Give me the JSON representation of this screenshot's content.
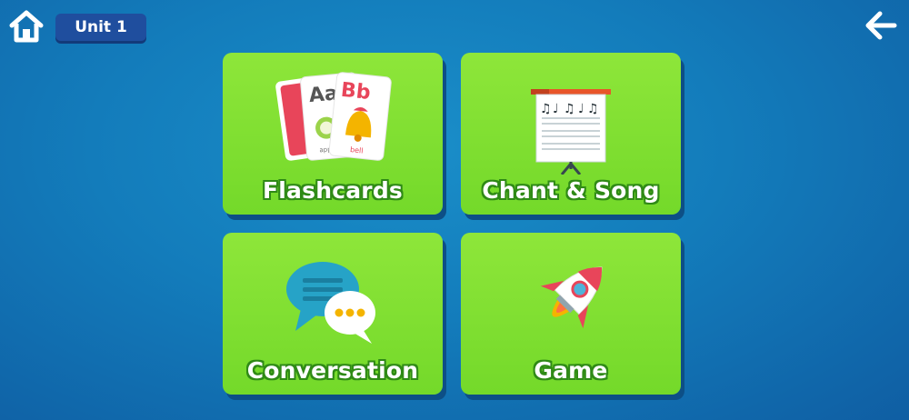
{
  "header": {
    "unit_label": "Unit 1",
    "home_icon": "home-icon",
    "back_icon": "arrow-left-icon"
  },
  "menu": {
    "items": [
      {
        "label": "Flashcards",
        "icon": "flashcards-icon"
      },
      {
        "label": "Chant & Song",
        "icon": "music-board-icon"
      },
      {
        "label": "Conversation",
        "icon": "chat-bubbles-icon"
      },
      {
        "label": "Game",
        "icon": "rocket-icon"
      }
    ]
  },
  "flashcards_art": {
    "card1_letters": "Aa",
    "card1_word": "apple",
    "card2_letters": "Bb",
    "card2_word": "bell"
  },
  "colors": {
    "background": "#137cbb",
    "card_green": "#7edd30",
    "badge_blue": "#1f4e9e"
  }
}
